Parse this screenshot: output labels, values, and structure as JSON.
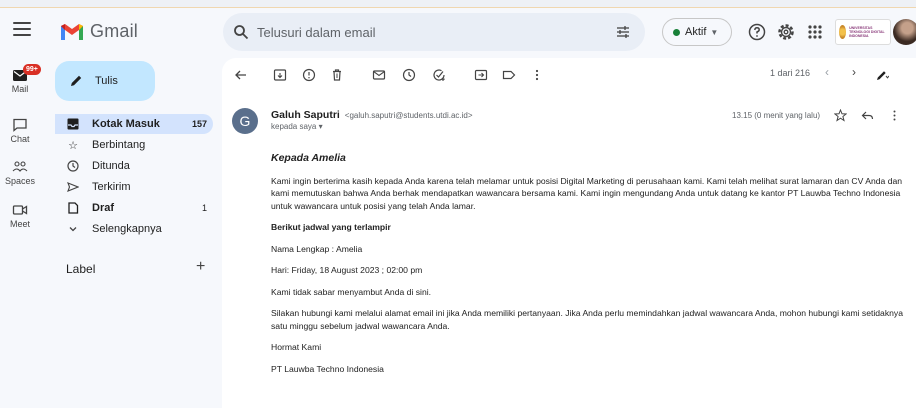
{
  "header": {
    "app_name": "Gmail",
    "search_placeholder": "Telusuri dalam email",
    "status_label": "Aktif",
    "status_color": "#188038",
    "icons": [
      "menu-icon",
      "search-icon",
      "filter-icon",
      "help-icon",
      "settings-icon",
      "apps-icon"
    ],
    "org_logo_text": "UNIVERSITAS TEKNOLOGI DIGITAL INDONESIA"
  },
  "rail": [
    {
      "label": "Mail",
      "badge": "99+",
      "icon": "mail-icon"
    },
    {
      "label": "Chat",
      "icon": "chat-icon"
    },
    {
      "label": "Spaces",
      "icon": "spaces-icon"
    },
    {
      "label": "Meet",
      "icon": "meet-icon"
    }
  ],
  "sidebar": {
    "compose_label": "Tulis",
    "items": [
      {
        "label": "Kotak Masuk",
        "count": "157",
        "icon": "inbox-icon"
      },
      {
        "label": "Berbintang",
        "count": "",
        "icon": "star-icon"
      },
      {
        "label": "Ditunda",
        "count": "",
        "icon": "clock-icon"
      },
      {
        "label": "Terkirim",
        "count": "",
        "icon": "send-icon"
      },
      {
        "label": "Draf",
        "count": "1",
        "icon": "draft-icon"
      },
      {
        "label": "Selengkapnya",
        "count": "",
        "icon": "chevron-down-icon"
      }
    ],
    "labels_heading": "Label",
    "labels_add": "+"
  },
  "toolbar": {
    "pager_text": "1 dari 216",
    "icons": [
      "back-icon",
      "archive-icon",
      "report-spam-icon",
      "delete-icon",
      "mark-unread-icon",
      "snooze-icon",
      "add-task-icon",
      "move-icon",
      "label-icon",
      "more-icon",
      "prev-icon",
      "next-icon",
      "pen-icon"
    ]
  },
  "message": {
    "avatar_letter": "G",
    "sender_name": "Galuh Saputri",
    "sender_email": "<galuh.saputri@students.utdi.ac.id>",
    "to": "kepada saya",
    "time": "13.15 (0 menit yang lalu)",
    "greeting": "Kepada Amelia",
    "paragraph1": "Kami ingin berterima kasih kepada Anda karena telah melamar untuk posisi Digital Marketing di perusahaan kami. Kami telah melihat surat lamaran dan CV Anda dan kami memutuskan bahwa Anda berhak mendapatkan wawancara bersama kami. Kami ingin mengundang Anda untuk datang ke kantor PT Lauwba Techno Indonesia untuk wawancara untuk posisi yang telah Anda lamar.",
    "schedule_heading": "Berikut jadwal yang terlampir",
    "full_name": "Nama Lengkap : Amelia",
    "date": "Hari: Friday, 18 August 2023 ; 02:00 pm",
    "closing_line": "Kami tidak sabar menyambut Anda di sini.",
    "paragraph2": "Silakan hubungi kami melalui alamat email ini jika Anda memiliki pertanyaan. Jika Anda perlu memindahkan jadwal wawancara Anda, mohon hubungi kami setidaknya satu minggu sebelum jadwal wawancara Anda.",
    "signoff": "Hormat Kami",
    "company": "PT Lauwba Techno Indonesia"
  }
}
